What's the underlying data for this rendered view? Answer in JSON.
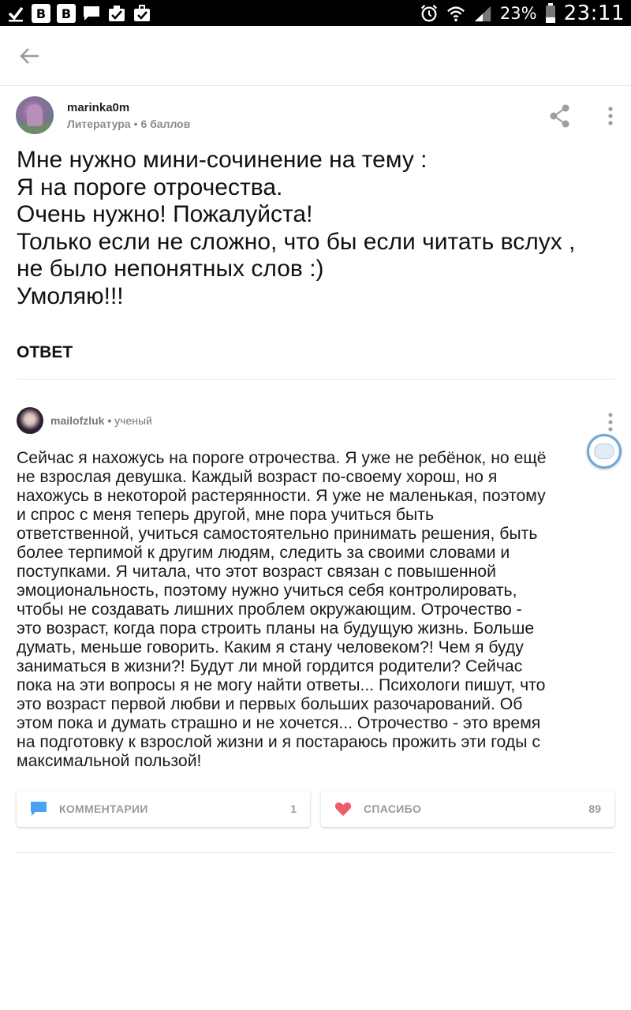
{
  "status_bar": {
    "left_icons": [
      "check-icon",
      "vk-icon",
      "vk-icon",
      "chat-icon",
      "tasks-icon",
      "briefcase-check-icon"
    ],
    "vk_glyph": "B",
    "right_icons": [
      "alarm-icon",
      "wifi-icon",
      "signal-icon",
      "battery-icon"
    ],
    "battery": "23%",
    "time": "23:11"
  },
  "question": {
    "username": "marinka0m",
    "subject": "Литература",
    "points": "6 баллов",
    "lines": [
      "Мне нужно мини-сочинение на тему :",
      "Я на пороге отрочества.",
      "Очень нужно! Пожалуйста!",
      "Только если не сложно, что бы если читать вслух ,",
      "не было непонятных слов :)",
      "Умоляю!!!"
    ]
  },
  "answer_label": "ОТВЕТ",
  "answer": {
    "username": "mailofzluk",
    "rank": "ученый",
    "lines": [
      "Сейчас я нахожусь на пороге отрочества. Я уже не ребёнок, но ещё",
      "не взрослая девушка. Каждый возраст по-своему хорош, но я",
      "нахожусь в некоторой растерянности. Я уже не маленькая, поэтому",
      "и спрос с меня теперь другой, мне пора учиться быть",
      "ответственной, учиться самостоятельно принимать решения, быть",
      "более терпимой к другим людям, следить за своими словами и",
      "поступками. Я читала, что этот возраст связан с повышенной",
      "эмоциональность, поэтому нужно учиться себя контролировать,",
      "чтобы не создавать лишних проблем окружающим. Отрочество -",
      "это возраст, когда пора строить планы на будущую жизнь. Больше",
      "думать, меньше говорить. Каким я стану человеком?! Чем я буду",
      "заниматься в жизни?! Будут ли мной гордится родители? Сейчас",
      "пока на эти вопросы я не могу найти ответы... Психологи пишут, что",
      "это возраст первой любви и первых больших разочарований. Об",
      "этом пока и думать страшно и не хочется... Отрочество - это время",
      "на подготовку к взрослой жизни и я постараюсь прожить эти годы с",
      "максимальной пользой!"
    ]
  },
  "actions": {
    "comments_label": "КОММЕНТАРИИ",
    "comments_count": "1",
    "thanks_label": "СПАСИБО",
    "thanks_count": "89"
  },
  "colors": {
    "comment_icon": "#4aa3f0",
    "heart_icon": "#ef5b66",
    "bubble_border": "#6fa5db"
  }
}
